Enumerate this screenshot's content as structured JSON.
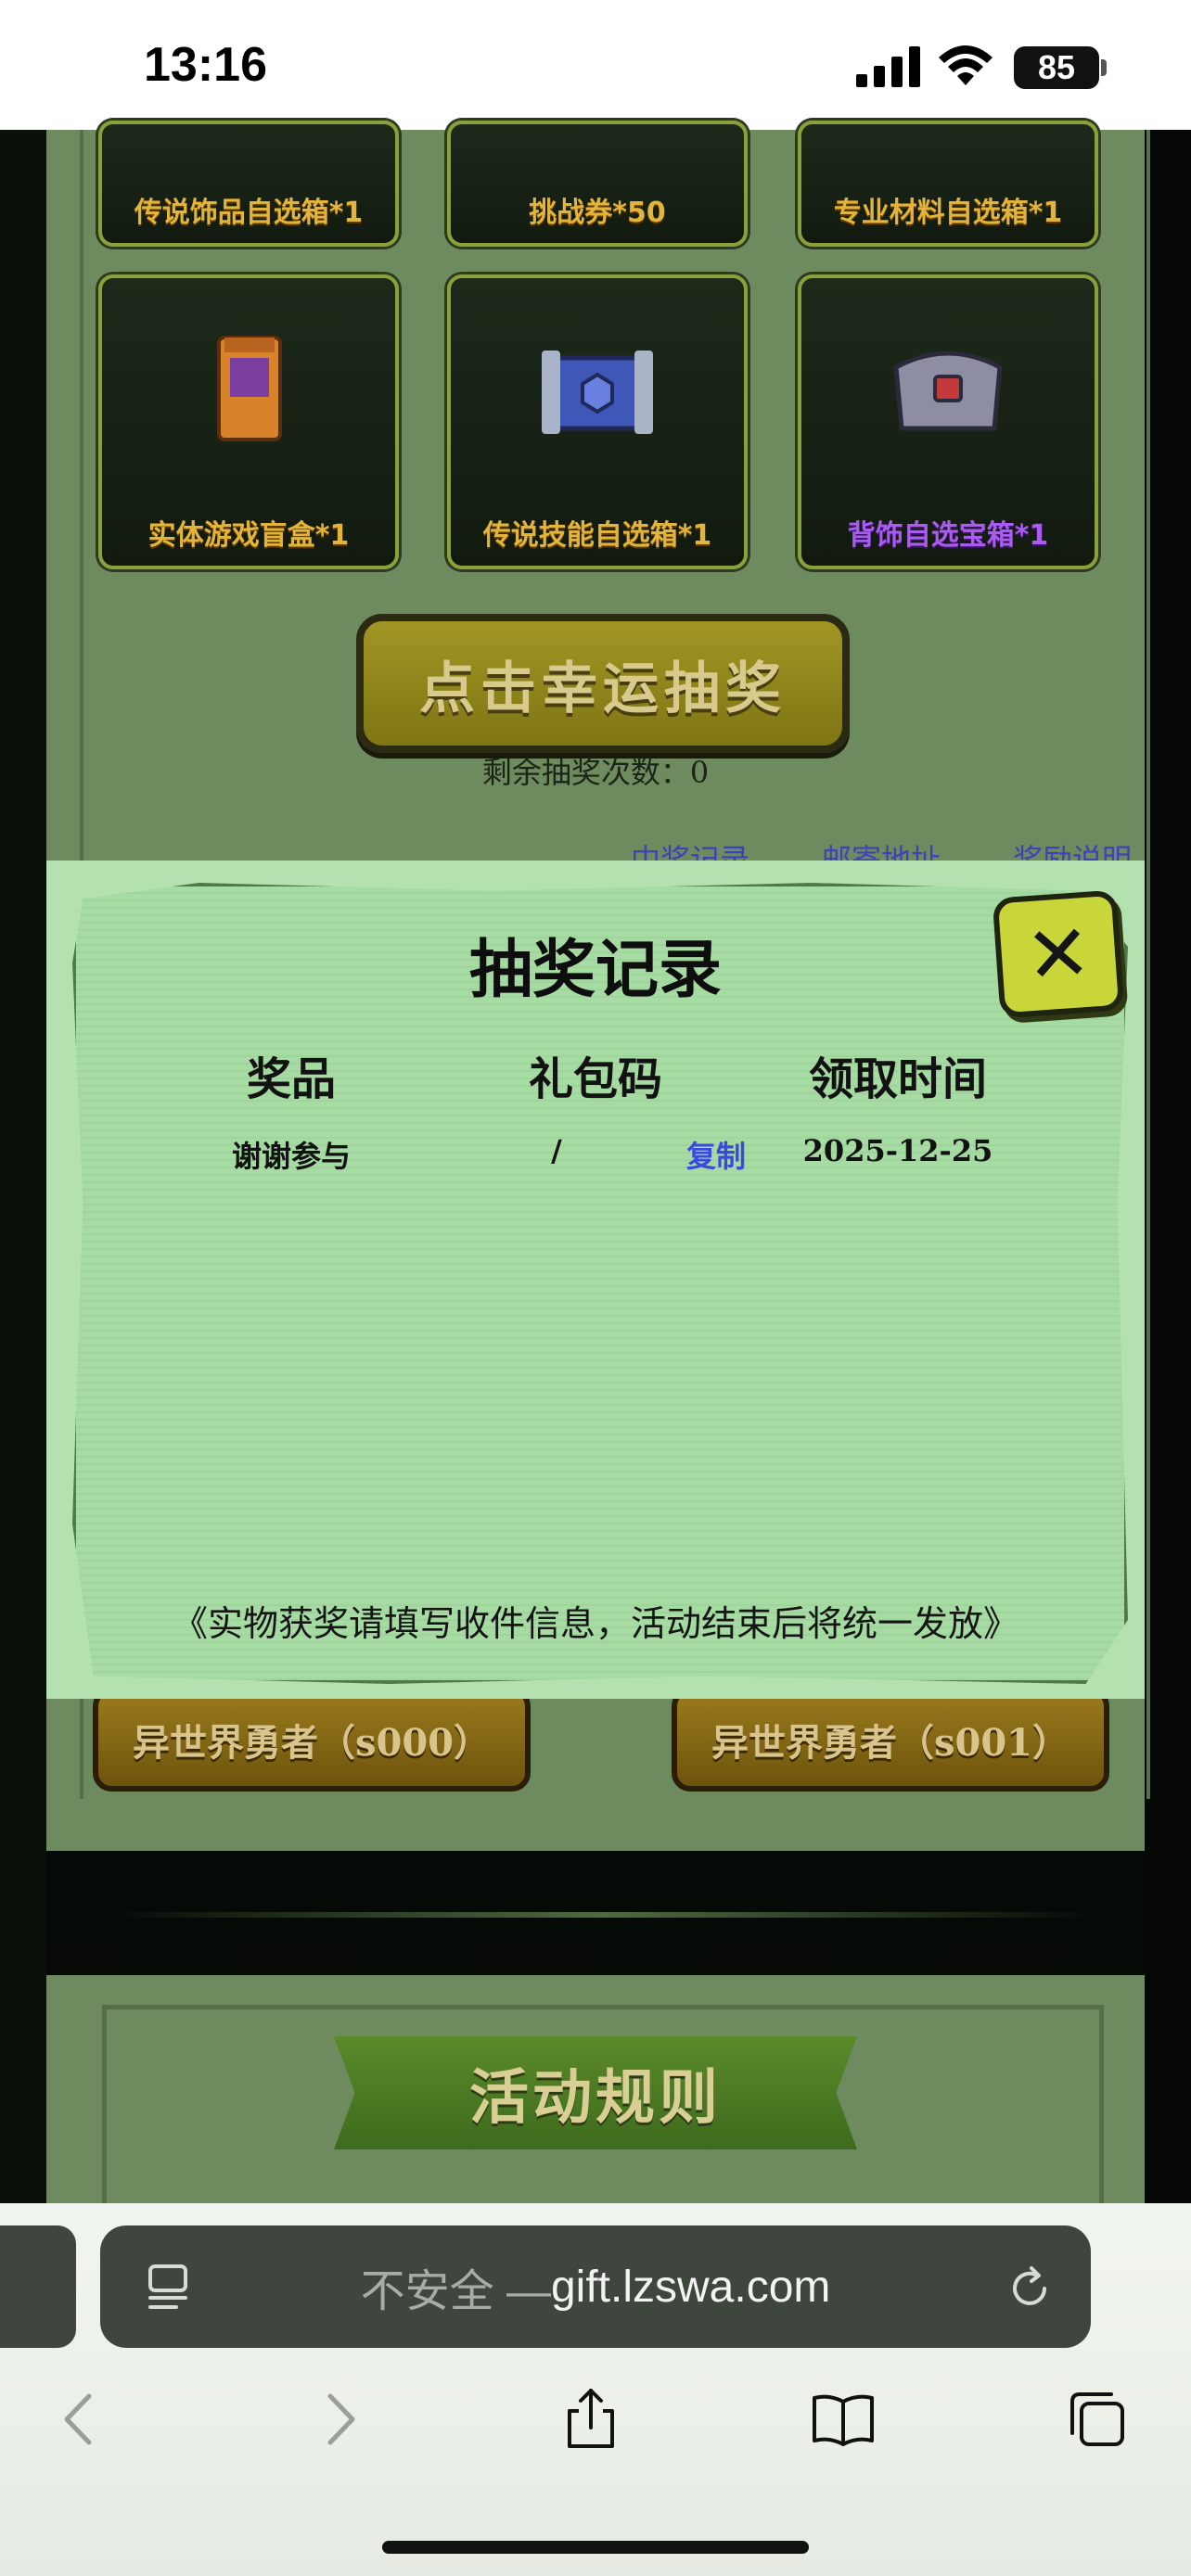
{
  "status_bar": {
    "time": "13:16",
    "battery": "85"
  },
  "prizes_top": [
    "传说饰品自选箱*1",
    "挑战券*50",
    "专业材料自选箱*1"
  ],
  "prizes_mid": [
    "实体游戏盲盒*1",
    "传说技能自选箱*1",
    "背饰自选宝箱*1"
  ],
  "lottery": {
    "button_label": "点击幸运抽奖",
    "remaining_label": "剩余抽奖次数：0"
  },
  "links": [
    "中奖记录",
    "邮寄地址",
    "奖励说明"
  ],
  "servers": [
    "异世界勇者（s000）",
    "异世界勇者（s001）"
  ],
  "rules_title": "活动规则",
  "modal": {
    "title": "抽奖记录",
    "columns": [
      "奖品",
      "礼包码",
      "领取时间"
    ],
    "rows": [
      {
        "prize": "谢谢参与",
        "code": "/",
        "copy_label": "复制",
        "time": "2025-12-25"
      }
    ],
    "note": "《实物获奖请填写收件信息，活动结束后将统一发放》"
  },
  "browser": {
    "url_prefix": "不安全 — ",
    "url_domain": "gift.lzswa.com"
  }
}
